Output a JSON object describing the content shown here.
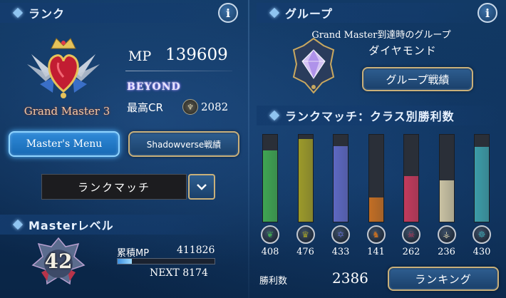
{
  "rank": {
    "header": "ランク",
    "rank_name": "Grand Master 3",
    "mp_label": "MP",
    "mp_value": "139609",
    "tier_logo": "BEYOND",
    "cr_label": "最高CR",
    "cr_value": "2082",
    "masters_menu": "Master's Menu",
    "battle_record": "Shadowverse戦績",
    "mode_select": "ランクマッチ"
  },
  "master_level": {
    "header": "Masterレベル",
    "level": "42",
    "cumulative_label": "累積MP",
    "cumulative_value": "411826",
    "next_label": "NEXT 8174",
    "progress_fraction": 0.15
  },
  "group": {
    "header": "グループ",
    "caption": "Grand Master到達時のグループ",
    "group_name": "ダイヤモンド",
    "group_record_button": "グループ戦績"
  },
  "class_wins": {
    "header": "ランクマッチ：クラス別勝利数",
    "total_label": "勝利数",
    "total_value": "2386",
    "ranking_button": "ランキング"
  },
  "chart_data": {
    "type": "bar",
    "title": "ランクマッチ：クラス別勝利数",
    "categories": [
      "forest",
      "sword",
      "rune",
      "dragon",
      "shadow",
      "blood",
      "haven"
    ],
    "values": [
      408,
      476,
      433,
      141,
      262,
      236,
      430
    ],
    "colors": [
      "#3fa552",
      "#9c9a2a",
      "#5d68c2",
      "#c26e24",
      "#c33a5c",
      "#c9c2a3",
      "#3c9ca8"
    ],
    "icons": [
      "leaf-icon",
      "crown-icon",
      "rune-icon",
      "dragon-icon",
      "skull-icon",
      "fang-icon",
      "haven-icon"
    ],
    "ylim": [
      0,
      500
    ]
  },
  "colors": {
    "accent_blue": "#2f8ad8",
    "gold_border": "#c9b07a"
  }
}
